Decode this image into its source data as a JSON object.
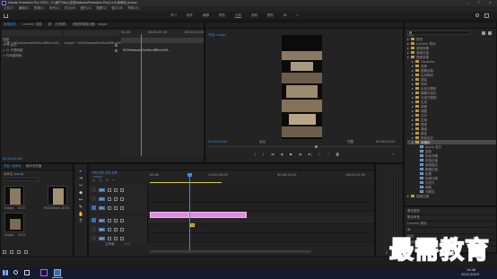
{
  "window": {
    "title": "Adobe Premiere Pro 2020 - C:\\用户\\hby\\文档\\Adobe\\Premiere Pro\\14.0\\未命名.prproj",
    "min": "—",
    "max": "☐",
    "close": "✕"
  },
  "menu": [
    "文件(F)",
    "编辑(E)",
    "剪辑(C)",
    "序列(S)",
    "标记(M)",
    "图形(G)",
    "视图(V)",
    "窗口(W)",
    "帮助(H)"
  ],
  "workspaces": [
    "学习",
    "组件",
    "编辑",
    "颜色",
    "效果",
    "音频",
    "图形",
    "库"
  ],
  "workspace_active": 4,
  "source_panel": {
    "tabs": [
      "效果控件",
      "Lumetri 范围",
      "源：(无剪辑)",
      "音频剪辑混合器：magic"
    ],
    "clip_label": "主要 * 903a5aada61e9bc46ffcc0d5...",
    "seq_label": "magic * 903a5aada61e9bc46ffcc0d5...",
    "rows": [
      "视频",
      "> fx 运动",
      "> fx 不透明度",
      "> 时间重映射"
    ],
    "timecode": "00:00:02:08",
    "ruler": [
      "00:00",
      "00:00:05:00",
      "00:00:10:00"
    ],
    "clip_name": "903a5aada61e9bc46ffcc0d5..."
  },
  "program_monitor": {
    "tab": "节目: magic",
    "timecode": "00:00:02:08",
    "fit": "适合",
    "quality": "完整",
    "duration": "00:00:04:03"
  },
  "effects_panel": {
    "tab": "效果",
    "items": [
      {
        "label": "预设",
        "level": 0,
        "kind": "folder"
      },
      {
        "label": "Lumetri 预设",
        "level": 0,
        "kind": "folder"
      },
      {
        "label": "音频效果",
        "level": 0,
        "kind": "folder"
      },
      {
        "label": "音频过渡",
        "level": 0,
        "kind": "folder"
      },
      {
        "label": "视频效果",
        "level": 0,
        "kind": "folder"
      },
      {
        "label": "Obsolete",
        "level": 1,
        "kind": "folder"
      },
      {
        "label": "变换",
        "level": 1,
        "kind": "folder"
      },
      {
        "label": "图像控制",
        "level": 1,
        "kind": "folder"
      },
      {
        "label": "实用程序",
        "level": 1,
        "kind": "folder"
      },
      {
        "label": "扭曲",
        "level": 1,
        "kind": "folder"
      },
      {
        "label": "时间",
        "level": 1,
        "kind": "folder"
      },
      {
        "label": "杂色与颗粒",
        "level": 1,
        "kind": "folder"
      },
      {
        "label": "模糊与锐化",
        "level": 1,
        "kind": "folder"
      },
      {
        "label": "沉浸式视频",
        "level": 1,
        "kind": "folder"
      },
      {
        "label": "生成",
        "level": 1,
        "kind": "folder"
      },
      {
        "label": "视频",
        "level": 1,
        "kind": "folder"
      },
      {
        "label": "调整",
        "level": 1,
        "kind": "folder"
      },
      {
        "label": "过时",
        "level": 1,
        "kind": "folder"
      },
      {
        "label": "过渡",
        "level": 1,
        "kind": "folder"
      },
      {
        "label": "透视",
        "level": 1,
        "kind": "folder"
      },
      {
        "label": "通道",
        "level": 1,
        "kind": "folder"
      },
      {
        "label": "键控",
        "level": 1,
        "kind": "folder"
      },
      {
        "label": "颜色校正",
        "level": 1,
        "kind": "folder"
      },
      {
        "label": "风格化",
        "level": 1,
        "kind": "folder",
        "selected": true
      },
      {
        "label": "Alpha 发光",
        "level": 2,
        "kind": "fx"
      },
      {
        "label": "复制",
        "level": 2,
        "kind": "fx"
      },
      {
        "label": "彩色浮雕",
        "level": 2,
        "kind": "fx"
      },
      {
        "label": "查找边缘",
        "level": 2,
        "kind": "fx"
      },
      {
        "label": "画笔描边",
        "level": 2,
        "kind": "fx"
      },
      {
        "label": "粗糙边缘",
        "level": 2,
        "kind": "fx"
      },
      {
        "label": "纹理",
        "level": 2,
        "kind": "fx"
      },
      {
        "label": "色调分离",
        "level": 2,
        "kind": "fx"
      },
      {
        "label": "闪光灯",
        "level": 2,
        "kind": "fx"
      },
      {
        "label": "阈值",
        "level": 2,
        "kind": "fx"
      },
      {
        "label": "马赛克",
        "level": 2,
        "kind": "fx"
      },
      {
        "label": "视频过渡",
        "level": 0,
        "kind": "folder"
      }
    ],
    "bottom_tabs": [
      "基本图形",
      "基本声音",
      "Lumetri 颜色",
      "库",
      "标记",
      "历史记录",
      "信息"
    ]
  },
  "project_panel": {
    "tabs": [
      "项目: 未命名",
      "媒体浏览器"
    ],
    "path": "未命名.prproj",
    "items": [
      {
        "name": "magic",
        "dur": "4:03"
      },
      {
        "name": "903a5aad...",
        "dur": "5:00"
      },
      {
        "name": "magic",
        "dur": "4:03"
      }
    ]
  },
  "timeline": {
    "tab": "magic",
    "timecode": "00:00:02:08",
    "ruler": [
      "00:00",
      "00:00:05:00",
      "00:00:10:00",
      "00:00:15:00"
    ],
    "tracks": [
      "V3",
      "V2",
      "V1",
      "A1",
      "A2",
      "A3"
    ],
    "master": "主声道",
    "master_val": "0.0",
    "clip_label": "magic.mp",
    "clip2_label": "903a5aada61...",
    "fx_badge": "fx"
  },
  "taskbar": {
    "time": "14:48",
    "date": "2021/10/15"
  },
  "watermark": "最需教育"
}
